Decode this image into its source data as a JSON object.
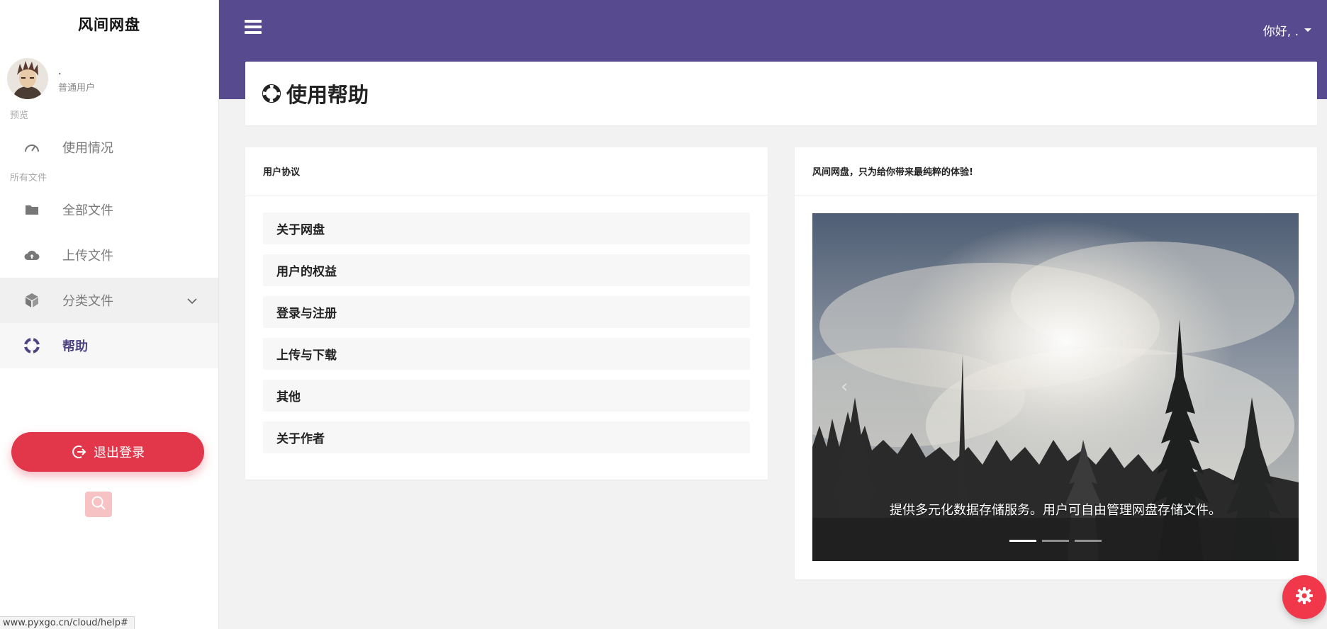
{
  "app": {
    "brand": "风间网盘"
  },
  "user": {
    "name": ".",
    "role": "普通用户"
  },
  "sidebar": {
    "sections": [
      {
        "label": "预览"
      },
      {
        "label": "所有文件"
      }
    ],
    "items": [
      {
        "label": "使用情况",
        "icon": "gauge-icon"
      },
      {
        "label": "全部文件",
        "icon": "folder-icon"
      },
      {
        "label": "上传文件",
        "icon": "cloud-upload-icon"
      },
      {
        "label": "分类文件",
        "icon": "cube-icon"
      },
      {
        "label": "帮助",
        "icon": "lifebuoy-icon"
      }
    ],
    "logout_label": "退出登录"
  },
  "header": {
    "greeting": "你好, ."
  },
  "page": {
    "title": "使用帮助"
  },
  "agreement": {
    "title": "用户协议",
    "items": [
      "关于网盘",
      "用户的权益",
      "登录与注册",
      "上传与下载",
      "其他",
      "关于作者"
    ]
  },
  "showcase": {
    "title": "风间网盘，只为给你带来最纯粹的体验!",
    "caption": "提供多元化数据存储服务。用户可自由管理网盘存储文件。",
    "slide_count": 3,
    "active_slide": 1
  },
  "status_bar": {
    "url": "www.pyxgo.cn/cloud/help#"
  },
  "colors": {
    "header": "#574a8f",
    "accent": "#4e4482",
    "danger": "#e2364a",
    "fab": "#f1384b"
  }
}
